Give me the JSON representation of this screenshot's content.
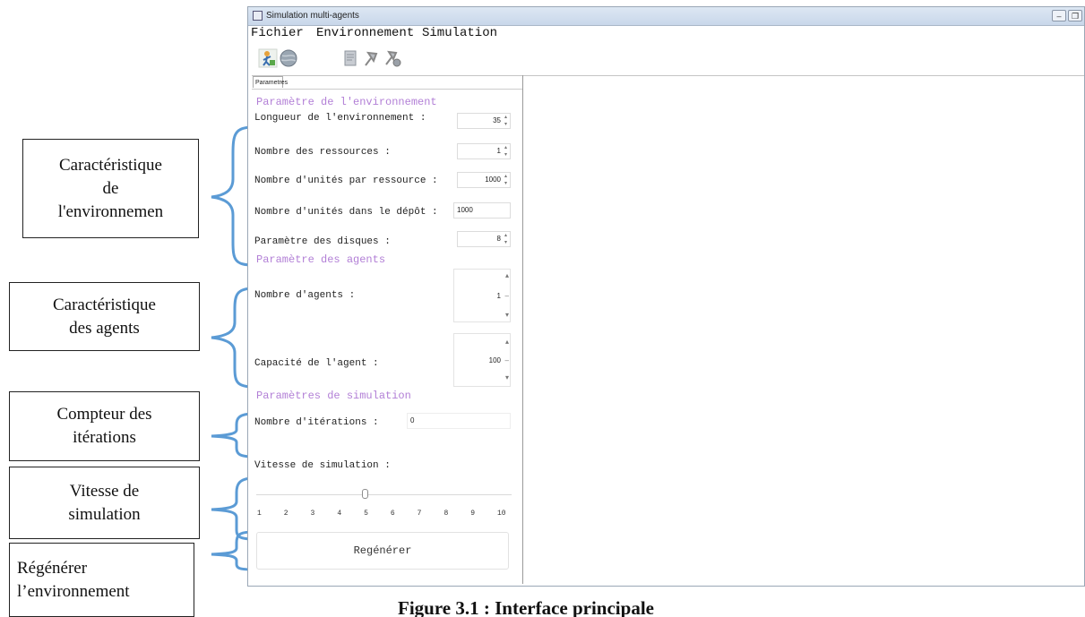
{
  "window": {
    "title": "Simulation multi-agents",
    "minimize_glyph": "–",
    "restore_glyph": "❐"
  },
  "menu": [
    "Fichier",
    "Environnement",
    "Simulation"
  ],
  "toolbar": {
    "icons": [
      "agent-run-icon",
      "globe-icon",
      "document-icon",
      "pin-icon",
      "pin-settings-icon"
    ]
  },
  "tab": {
    "label": "Parametres"
  },
  "env_section": {
    "title": "Paramètre de l'environnement",
    "rows": [
      {
        "label": "Longueur de l'environnement :",
        "value": "35"
      },
      {
        "label": "Nombre des ressources :",
        "value": "1"
      },
      {
        "label": "Nombre d'unités par ressource :",
        "value": "1000"
      },
      {
        "label": "Nombre d'unités dans le dépôt :",
        "value": "1000"
      },
      {
        "label": "Paramètre des disques :",
        "value": "8"
      }
    ]
  },
  "agents_section": {
    "title": "Paramètre des agents",
    "agents_label": "Nombre d'agents :",
    "agents_value": "1",
    "capacity_label": "Capacité de l'agent :",
    "capacity_value": "100"
  },
  "sim_section": {
    "title": "Paramètres de simulation",
    "iterations_label": "Nombre d'itérations :",
    "iterations_value": "0",
    "speed_label": "Vitesse de simulation :",
    "speed_value": 5,
    "speed_ticks": [
      "1",
      "2",
      "3",
      "4",
      "5",
      "6",
      "7",
      "8",
      "9",
      "10"
    ]
  },
  "regen_button": "Regénérer",
  "annotations": [
    "Caractéristique\nde\nl'environnemen",
    "Caractéristique\ndes agents",
    "Compteur des\nitérations",
    "Vitesse de\nsimulation",
    "Régénérer\nl’environnement"
  ],
  "caption": "Figure 3.1 : Interface principale"
}
